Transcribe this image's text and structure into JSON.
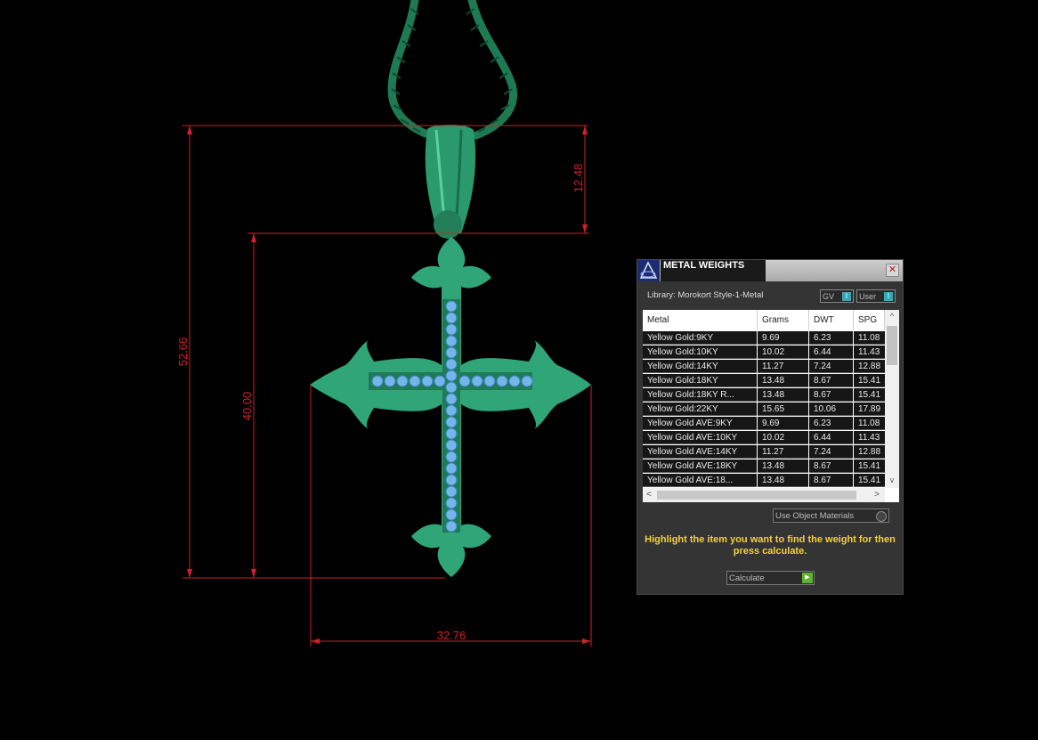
{
  "dimensions": {
    "overall_height": "52.66",
    "cross_height": "40.00",
    "bail_height": "12.48",
    "width": "32.76"
  },
  "panel": {
    "title": "METAL WEIGHTS",
    "close_glyph": "✕",
    "library": "Library: Morokort Style-1-Metal",
    "toggle_gv": "GV",
    "toggle_user": "User",
    "toggle_knob": "I",
    "columns": [
      "Metal",
      "Grams",
      "DWT",
      "SPG"
    ],
    "rows": [
      [
        "Yellow Gold:9KY",
        "9.69",
        "6.23",
        "11.08"
      ],
      [
        "Yellow Gold:10KY",
        "10.02",
        "6.44",
        "11.43"
      ],
      [
        "Yellow Gold:14KY",
        "11.27",
        "7.24",
        "12.88"
      ],
      [
        "Yellow Gold:18KY",
        "13.48",
        "8.67",
        "15.41"
      ],
      [
        "Yellow Gold:18KY R...",
        "13.48",
        "8.67",
        "15.41"
      ],
      [
        "Yellow Gold:22KY",
        "15.65",
        "10.06",
        "17.89"
      ],
      [
        "Yellow Gold AVE:9KY",
        "9.69",
        "6.23",
        "11.08"
      ],
      [
        "Yellow Gold AVE:10KY",
        "10.02",
        "6.44",
        "11.43"
      ],
      [
        "Yellow Gold AVE:14KY",
        "11.27",
        "7.24",
        "12.88"
      ],
      [
        "Yellow Gold AVE:18KY",
        "13.48",
        "8.67",
        "15.41"
      ],
      [
        "Yellow Gold AVE:18...",
        "13.48",
        "8.67",
        "15.41"
      ]
    ],
    "use_object_materials": "Use Object Materials",
    "instructions": "Highlight the item you want to find the weight for then press calculate.",
    "calculate": "Calculate",
    "scroll_up": "^",
    "scroll_down": "v",
    "scroll_left": "<",
    "scroll_right": ">"
  },
  "colors": {
    "background": "#000000",
    "dimension_lines": "#d0202a",
    "pendant": "#2fa578",
    "chain": "#1d7a52",
    "stones": "#74b6e8",
    "instructions_text": "#f2d23c"
  }
}
